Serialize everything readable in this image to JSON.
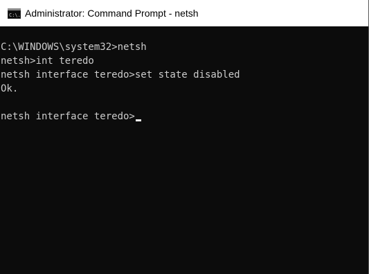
{
  "window": {
    "title": "Administrator: Command Prompt - netsh",
    "icon": "command-prompt-icon",
    "icon_label": "C:\\."
  },
  "colors": {
    "console_background": "#0c0c0c",
    "console_text": "#cccccc",
    "titlebar_background": "#ffffff",
    "cursor": "#f2f2f2"
  },
  "console": {
    "lines": [
      "C:\\WINDOWS\\system32>netsh",
      "netsh>int teredo",
      "netsh interface teredo>set state disabled",
      "Ok.",
      "",
      "netsh interface teredo>"
    ]
  }
}
